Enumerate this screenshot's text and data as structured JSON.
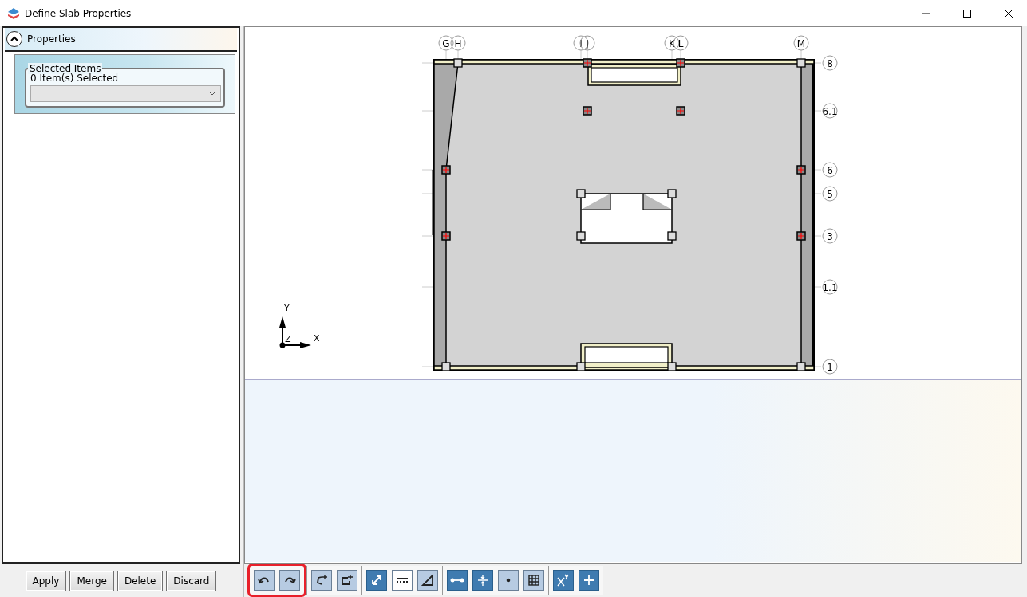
{
  "window": {
    "title": "Define Slab Properties"
  },
  "properties_panel": {
    "title": "Properties",
    "expanded": true,
    "group": {
      "title": "Selected Items",
      "count_text": "0 Item(s) Selected"
    }
  },
  "actions": [
    "Apply",
    "Merge",
    "Delete",
    "Discard"
  ],
  "plan": {
    "grid_columns": [
      "G",
      "H",
      "I",
      "J",
      "K",
      "L",
      "M"
    ],
    "grid_rows": [
      "8",
      "6.1",
      "6",
      "5",
      "3",
      "1.1",
      "1"
    ],
    "axes": {
      "y": "Y",
      "z": "Z",
      "x": "X"
    }
  },
  "toolbar": {
    "groups": [
      {
        "highlighted": true,
        "tools": [
          {
            "kind": "undo",
            "on": false
          },
          {
            "kind": "redo",
            "on": false
          }
        ]
      },
      {
        "highlighted": false,
        "tools": [
          {
            "kind": "vertex",
            "on": false
          },
          {
            "kind": "rect",
            "on": false
          }
        ]
      },
      {
        "highlighted": false,
        "tools": [
          {
            "kind": "resize",
            "on": true
          },
          {
            "kind": "dashes",
            "on": false
          },
          {
            "kind": "angle",
            "on": false
          }
        ]
      },
      {
        "highlighted": false,
        "tools": [
          {
            "kind": "dimension",
            "on": true
          },
          {
            "kind": "split",
            "on": true
          },
          {
            "kind": "dot",
            "on": false
          },
          {
            "kind": "grid",
            "on": false
          }
        ]
      },
      {
        "highlighted": false,
        "tools": [
          {
            "kind": "power",
            "on": true
          },
          {
            "kind": "plus",
            "on": true
          }
        ]
      }
    ]
  }
}
